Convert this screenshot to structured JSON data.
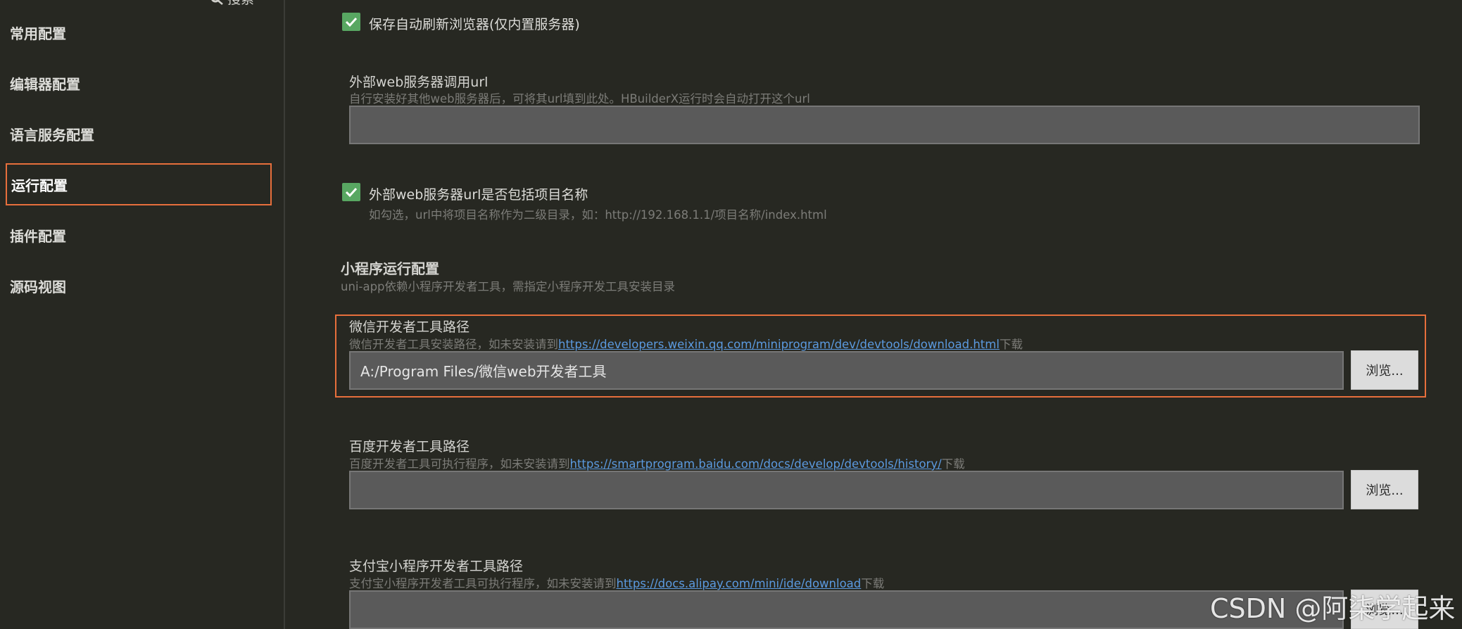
{
  "sidebar": {
    "search_label": "搜索",
    "items": [
      {
        "label": "常用配置"
      },
      {
        "label": "编辑器配置"
      },
      {
        "label": "语言服务配置"
      },
      {
        "label": "运行配置",
        "active": true
      },
      {
        "label": "插件配置"
      },
      {
        "label": "源码视图"
      }
    ]
  },
  "main": {
    "auto_refresh": {
      "label": "保存自动刷新浏览器(仅内置服务器)",
      "checked": true
    },
    "external_url": {
      "label": "外部web服务器调用url",
      "hint": "自行安装好其他web服务器后，可将其url填到此处。HBuilderX运行时会自动打开这个url",
      "value": ""
    },
    "include_project_name": {
      "label": "外部web服务器url是否包括项目名称",
      "checked": true,
      "hint": "如勾选，url中将项目名称作为二级目录，如：http://192.168.1.1/项目名称/index.html"
    },
    "miniprogram": {
      "title": "小程序运行配置",
      "subtitle": "uni-app依赖小程序开发者工具，需指定小程序开发工具安装目录"
    },
    "wechat": {
      "label": "微信开发者工具路径",
      "hint_prefix": "微信开发者工具安装路径，如未安装请到",
      "link": "https://developers.weixin.qq.com/miniprogram/dev/devtools/download.html",
      "hint_suffix": "下载",
      "value": "A:/Program Files/微信web开发者工具",
      "browse": "浏览..."
    },
    "baidu": {
      "label": "百度开发者工具路径",
      "hint_prefix": "百度开发者工具可执行程序，如未安装请到",
      "link": "https://smartprogram.baidu.com/docs/develop/devtools/history/",
      "hint_suffix": "下载",
      "value": "",
      "browse": "浏览..."
    },
    "alipay": {
      "label": "支付宝小程序开发者工具路径",
      "hint_prefix": "支付宝小程序开发者工具可执行程序，如未安装请到",
      "link": "https://docs.alipay.com/mini/ide/download",
      "hint_suffix": "下载",
      "value": "",
      "browse": "浏览..."
    }
  },
  "watermark": "CSDN @阿柒学起来",
  "colors": {
    "accent_border": "#e76f3c",
    "checkbox": "#58a762",
    "link": "#5b9ae0"
  }
}
